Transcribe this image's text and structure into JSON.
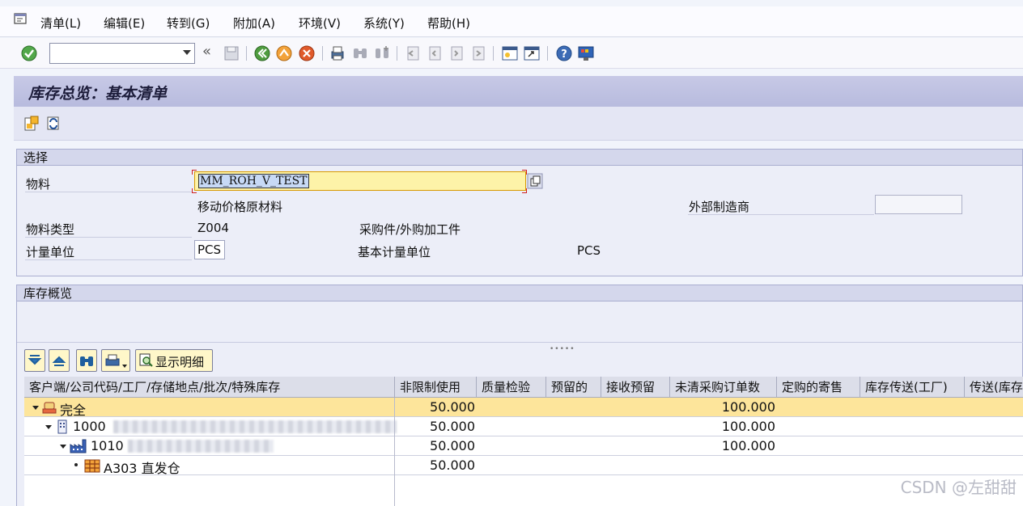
{
  "menu": {
    "items": [
      "清单(L)",
      "编辑(E)",
      "转到(G)",
      "附加(A)",
      "环境(V)",
      "系统(Y)",
      "帮助(H)"
    ]
  },
  "toolbar": {
    "command_field_value": "",
    "icons": [
      "enter-icon",
      "back-double-icon",
      "save-icon",
      "back-icon",
      "exit-icon",
      "cancel-icon",
      "print-icon",
      "find-icon",
      "find-next-icon",
      "first-page-icon",
      "previous-page-icon",
      "next-page-icon",
      "last-page-icon",
      "create-session-icon",
      "shortcut-icon",
      "help-icon",
      "customize-layout-icon"
    ]
  },
  "title": "库存总览：基本清单",
  "selection": {
    "header": "选择",
    "material_label": "物料",
    "material_value": "MM_ROH_V_TEST",
    "material_desc": "移动价格原材料",
    "manufacturer_label": "外部制造商",
    "material_type_label": "物料类型",
    "material_type_value": "Z004",
    "material_type_desc": "采购件/外购加工件",
    "uom_label": "计量单位",
    "uom_value": "PCS",
    "base_uom_label": "基本计量单位",
    "base_uom_value": "PCS"
  },
  "overview": {
    "header": "库存概览",
    "detail_button": "显示明细",
    "columns": [
      "客户端/公司代码/工厂/存储地点/批次/特殊库存",
      "非限制使用",
      "质量检验",
      "预留的",
      "接收预留",
      "未清采购订单数",
      "定购的寄售",
      "库存传送(工厂)",
      "传送(库存"
    ],
    "rows": [
      {
        "label": "完全",
        "unrestricted": "50.000",
        "open_po": "100.000"
      },
      {
        "label": "1000",
        "unrestricted": "50.000",
        "open_po": "100.000"
      },
      {
        "label": "1010",
        "unrestricted": "50.000",
        "open_po": "100.000"
      },
      {
        "label": "A303 直发仓",
        "unrestricted": "50.000",
        "open_po": ""
      }
    ]
  },
  "watermark": "CSDN @左甜甜"
}
